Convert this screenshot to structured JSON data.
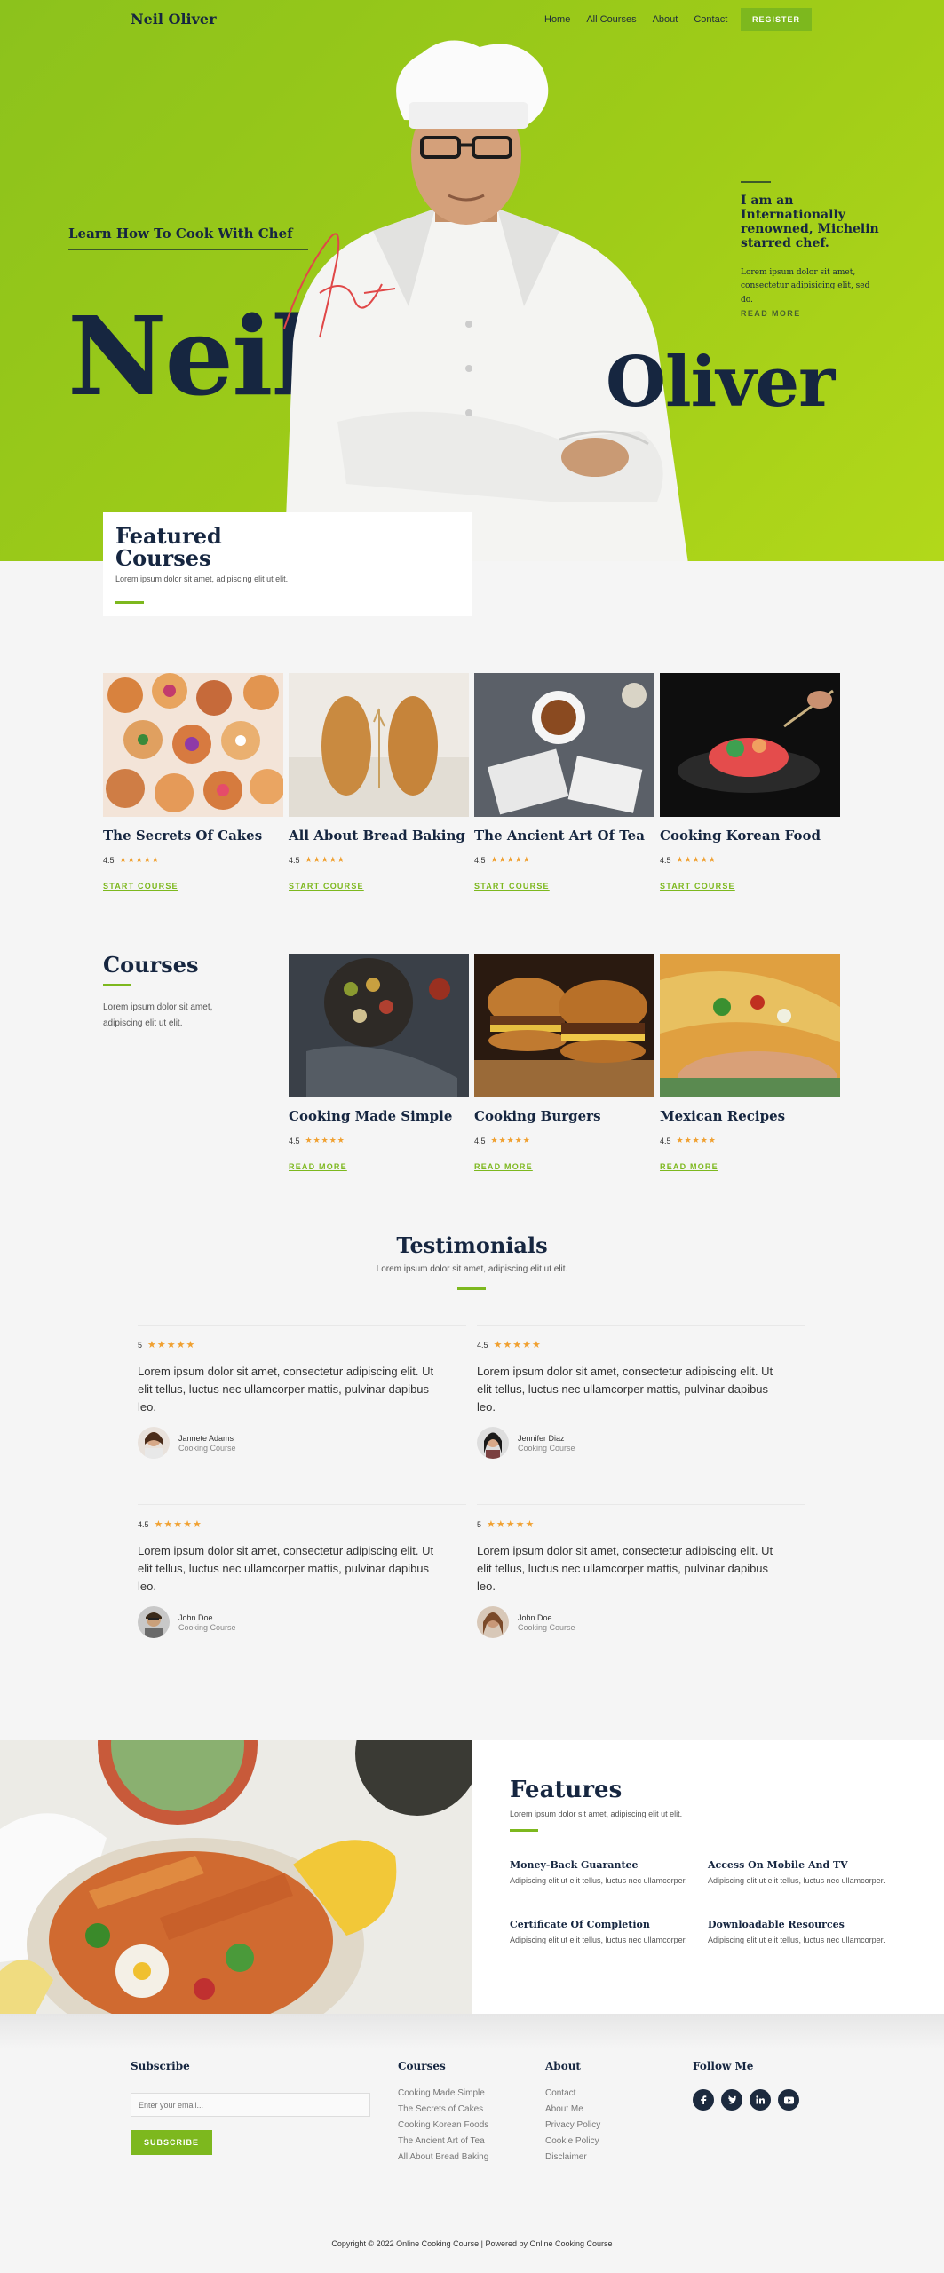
{
  "header": {
    "brand": "Neil Oliver",
    "nav": [
      "Home",
      "All Courses",
      "About",
      "Contact"
    ],
    "register_label": "REGISTER"
  },
  "hero": {
    "tagline": "Learn How To Cook With Chef",
    "first_name": "Neil",
    "last_name": "Oliver",
    "intro_title": "I am an Internationally renowned, Michelin starred chef.",
    "intro_text": "Lorem ipsum dolor sit amet, consectetur adipisicing elit, sed do.",
    "intro_link": "READ MORE"
  },
  "featured": {
    "title_line1": "Featured",
    "title_line2": "Courses",
    "subtitle": "Lorem ipsum dolor sit amet, adipiscing elit ut elit.",
    "items": [
      {
        "title": "The Secrets Of Cakes",
        "rating": "4.5",
        "link": "START COURSE"
      },
      {
        "title": "All About Bread Baking",
        "rating": "4.5",
        "link": "START COURSE"
      },
      {
        "title": "The Ancient Art Of Tea",
        "rating": "4.5",
        "link": "START COURSE"
      },
      {
        "title": "Cooking Korean Food",
        "rating": "4.5",
        "link": "START COURSE"
      }
    ]
  },
  "courses": {
    "title": "Courses",
    "text": "Lorem ipsum dolor sit amet, adipiscing elit ut elit.",
    "items": [
      {
        "title": "Cooking Made Simple",
        "rating": "4.5",
        "link": "READ MORE"
      },
      {
        "title": "Cooking Burgers",
        "rating": "4.5",
        "link": "READ MORE"
      },
      {
        "title": "Mexican Recipes",
        "rating": "4.5",
        "link": "READ MORE"
      }
    ]
  },
  "testimonials": {
    "title": "Testimonials",
    "subtitle": "Lorem ipsum dolor sit amet, adipiscing elit ut elit.",
    "items": [
      {
        "rating": "5",
        "quote": "Lorem ipsum dolor sit amet, consectetur adipiscing elit. Ut elit tellus, luctus nec ullamcorper mattis, pulvinar dapibus leo.",
        "name": "Jannete Adams",
        "role": "Cooking Course"
      },
      {
        "rating": "4.5",
        "quote": "Lorem ipsum dolor sit amet, consectetur adipiscing elit. Ut elit tellus, luctus nec ullamcorper mattis, pulvinar dapibus leo.",
        "name": "Jennifer Diaz",
        "role": "Cooking Course"
      },
      {
        "rating": "4.5",
        "quote": "Lorem ipsum dolor sit amet, consectetur adipiscing elit. Ut elit tellus, luctus nec ullamcorper mattis, pulvinar dapibus leo.",
        "name": "John Doe",
        "role": "Cooking Course"
      },
      {
        "rating": "5",
        "quote": "Lorem ipsum dolor sit amet, consectetur adipiscing elit. Ut elit tellus, luctus nec ullamcorper mattis, pulvinar dapibus leo.",
        "name": "John Doe",
        "role": "Cooking Course"
      }
    ]
  },
  "features": {
    "title": "Features",
    "subtitle": "Lorem ipsum dolor sit amet, adipiscing elit ut elit.",
    "items": [
      {
        "title": "Money-Back Guarantee",
        "text": "Adipiscing elit ut elit tellus, luctus nec ullamcorper."
      },
      {
        "title": "Access On Mobile And TV",
        "text": "Adipiscing elit ut elit tellus, luctus nec ullamcorper."
      },
      {
        "title": "Certificate Of Completion",
        "text": "Adipiscing elit ut elit tellus, luctus nec ullamcorper."
      },
      {
        "title": "Downloadable Resources",
        "text": "Adipiscing elit ut elit tellus, luctus nec ullamcorper."
      }
    ]
  },
  "footer": {
    "subscribe_title": "Subscribe",
    "email_placeholder": "Enter your email...",
    "subscribe_label": "SUBSCRIBE",
    "courses_title": "Courses",
    "courses_links": [
      "Cooking Made Simple",
      "The Secrets of Cakes",
      "Cooking Korean Foods",
      "The Ancient Art of Tea",
      "All About Bread Baking"
    ],
    "about_title": "About",
    "about_links": [
      "Contact",
      "About Me",
      "Privacy Policy",
      "Cookie Policy",
      "Disclaimer"
    ],
    "follow_title": "Follow Me",
    "socials": [
      "facebook-icon",
      "twitter-icon",
      "linkedin-icon",
      "youtube-icon"
    ],
    "copyright": "Copyright © 2022 Online Cooking Course | Powered by Online Cooking Course"
  },
  "colors": {
    "accent": "#7db81e",
    "navy": "#162640",
    "hero_green": "#9fcc18",
    "star": "#f0a030"
  }
}
